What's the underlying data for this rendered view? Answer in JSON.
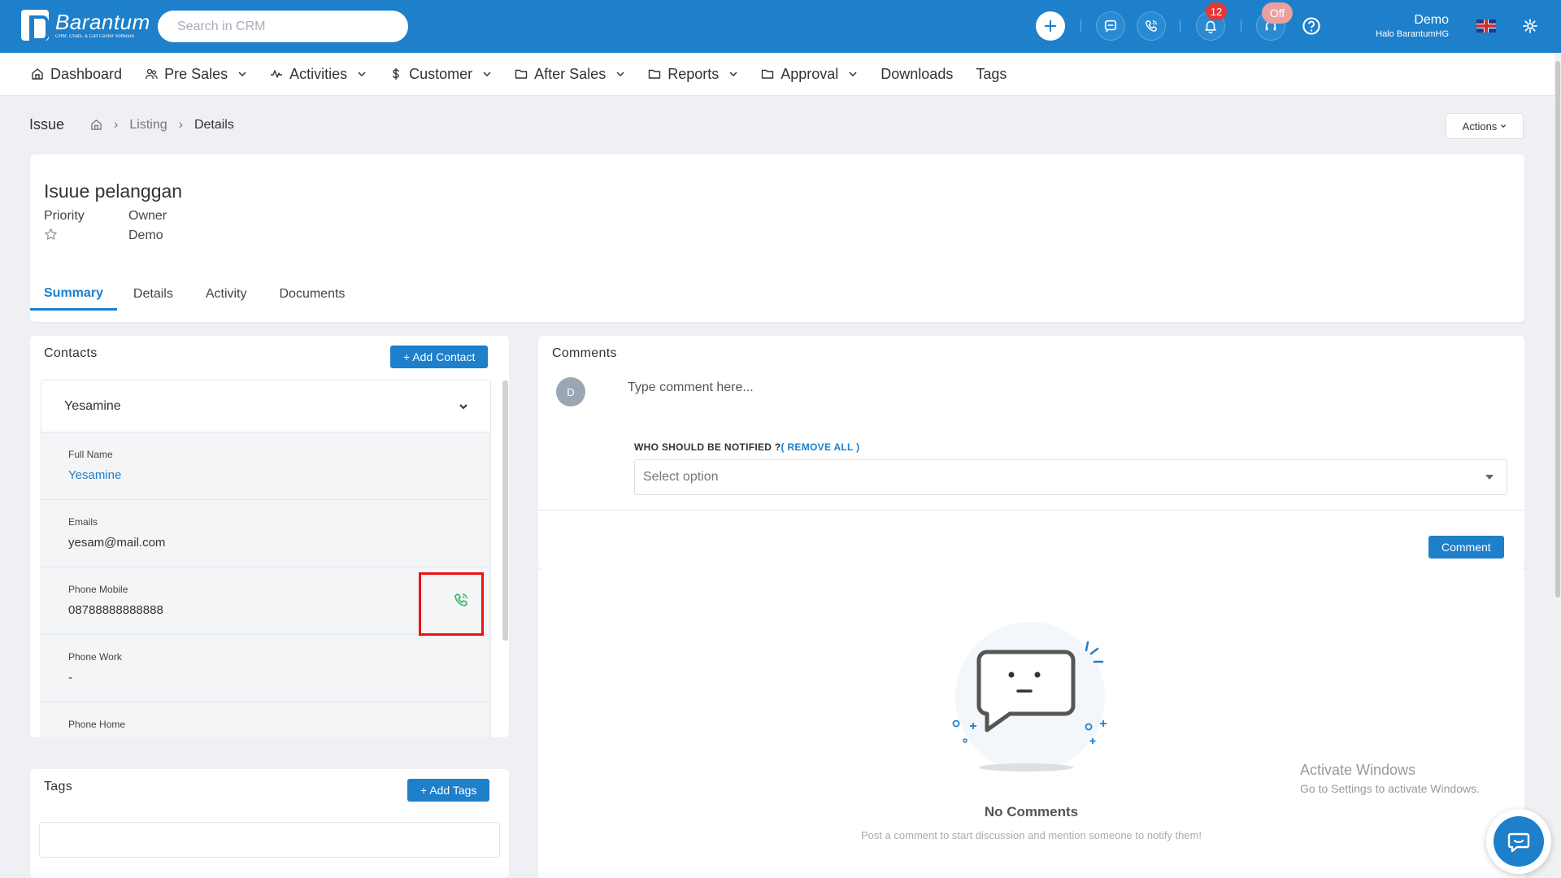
{
  "brand": {
    "name": "Barantum",
    "tagline": "CRM, Chats, & Call Center Software"
  },
  "search": {
    "placeholder": "Search in CRM"
  },
  "topbar": {
    "notification_count": "12",
    "status_badge": "Off",
    "user_name": "Demo",
    "user_org": "Halo BarantumHG"
  },
  "nav": {
    "items": [
      {
        "label": "Dashboard",
        "icon": "home-icon",
        "dropdown": false
      },
      {
        "label": "Pre Sales",
        "icon": "users-icon",
        "dropdown": true
      },
      {
        "label": "Activities",
        "icon": "pulse-icon",
        "dropdown": true
      },
      {
        "label": "Customer",
        "icon": "dollar-icon",
        "dropdown": true
      },
      {
        "label": "After Sales",
        "icon": "folder-icon",
        "dropdown": true
      },
      {
        "label": "Reports",
        "icon": "folder-icon",
        "dropdown": true
      },
      {
        "label": "Approval",
        "icon": "folder-icon",
        "dropdown": true
      },
      {
        "label": "Downloads",
        "icon": "",
        "dropdown": false
      },
      {
        "label": "Tags",
        "icon": "",
        "dropdown": false
      }
    ]
  },
  "breadcrumb": {
    "title": "Issue",
    "listing": "Listing",
    "current": "Details"
  },
  "actions_label": "Actions",
  "issue": {
    "title": "Isuue pelanggan",
    "priority_label": "Priority",
    "owner_label": "Owner",
    "owner_value": "Demo"
  },
  "tabs": [
    "Summary",
    "Details",
    "Activity",
    "Documents"
  ],
  "contacts": {
    "title": "Contacts",
    "add_label": "+ Add Contact",
    "selected": "Yesamine",
    "fields": [
      {
        "label": "Full Name",
        "value": "Yesamine"
      },
      {
        "label": "Emails",
        "value": "yesam@mail.com"
      },
      {
        "label": "Phone Mobile",
        "value": "08788888888888"
      },
      {
        "label": "Phone Work",
        "value": "-"
      },
      {
        "label": "Phone Home",
        "value": ""
      }
    ]
  },
  "tags": {
    "title": "Tags",
    "add_label": "+ Add Tags"
  },
  "comments": {
    "title": "Comments",
    "avatar_initial": "D",
    "placeholder": "Type comment here...",
    "notify_label": "WHO SHOULD BE NOTIFIED ?",
    "remove_all": "( REMOVE ALL )",
    "select_placeholder": "Select option",
    "submit_label": "Comment",
    "empty_title": "No Comments",
    "empty_sub": "Post a comment to start discussion and mention someone to notify them!"
  },
  "watermark": {
    "line1": "Activate Windows",
    "line2": "Go to Settings to activate Windows."
  },
  "colors": {
    "primary": "#1e7fcb",
    "call_green": "#2eb85c",
    "alert_red": "#e53935"
  }
}
